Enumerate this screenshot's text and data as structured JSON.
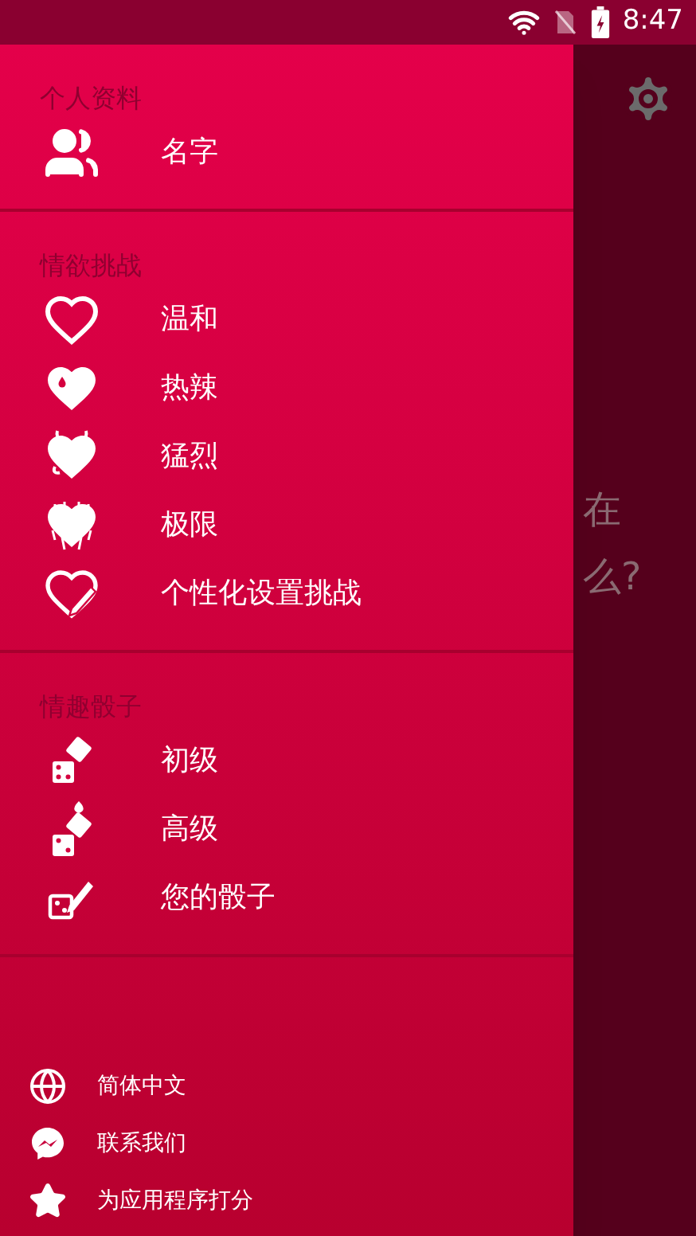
{
  "status_bar": {
    "time": "8:47"
  },
  "background_text": [
    "在",
    "么?"
  ],
  "drawer": {
    "sections": [
      {
        "header": "个人资料",
        "items": [
          {
            "kind": "people",
            "label": "名字"
          }
        ]
      },
      {
        "header": "情欲挑战",
        "items": [
          {
            "kind": "heart-outline",
            "label": "温和"
          },
          {
            "kind": "heart-drop",
            "label": "热辣"
          },
          {
            "kind": "heart-devil",
            "label": "猛烈"
          },
          {
            "kind": "heart-jagged",
            "label": "极限"
          },
          {
            "kind": "heart-pencil",
            "label": "个性化设置挑战"
          }
        ]
      },
      {
        "header": "情趣骰子",
        "items": [
          {
            "kind": "dice",
            "label": "初级"
          },
          {
            "kind": "dice-flame",
            "label": "高级"
          },
          {
            "kind": "dice-pencil",
            "label": "您的骰子"
          }
        ]
      }
    ],
    "footer": [
      {
        "kind": "globe",
        "label": "简体中文"
      },
      {
        "kind": "messenger",
        "label": "联系我们"
      },
      {
        "kind": "star",
        "label": "为应用程序打分"
      }
    ]
  }
}
